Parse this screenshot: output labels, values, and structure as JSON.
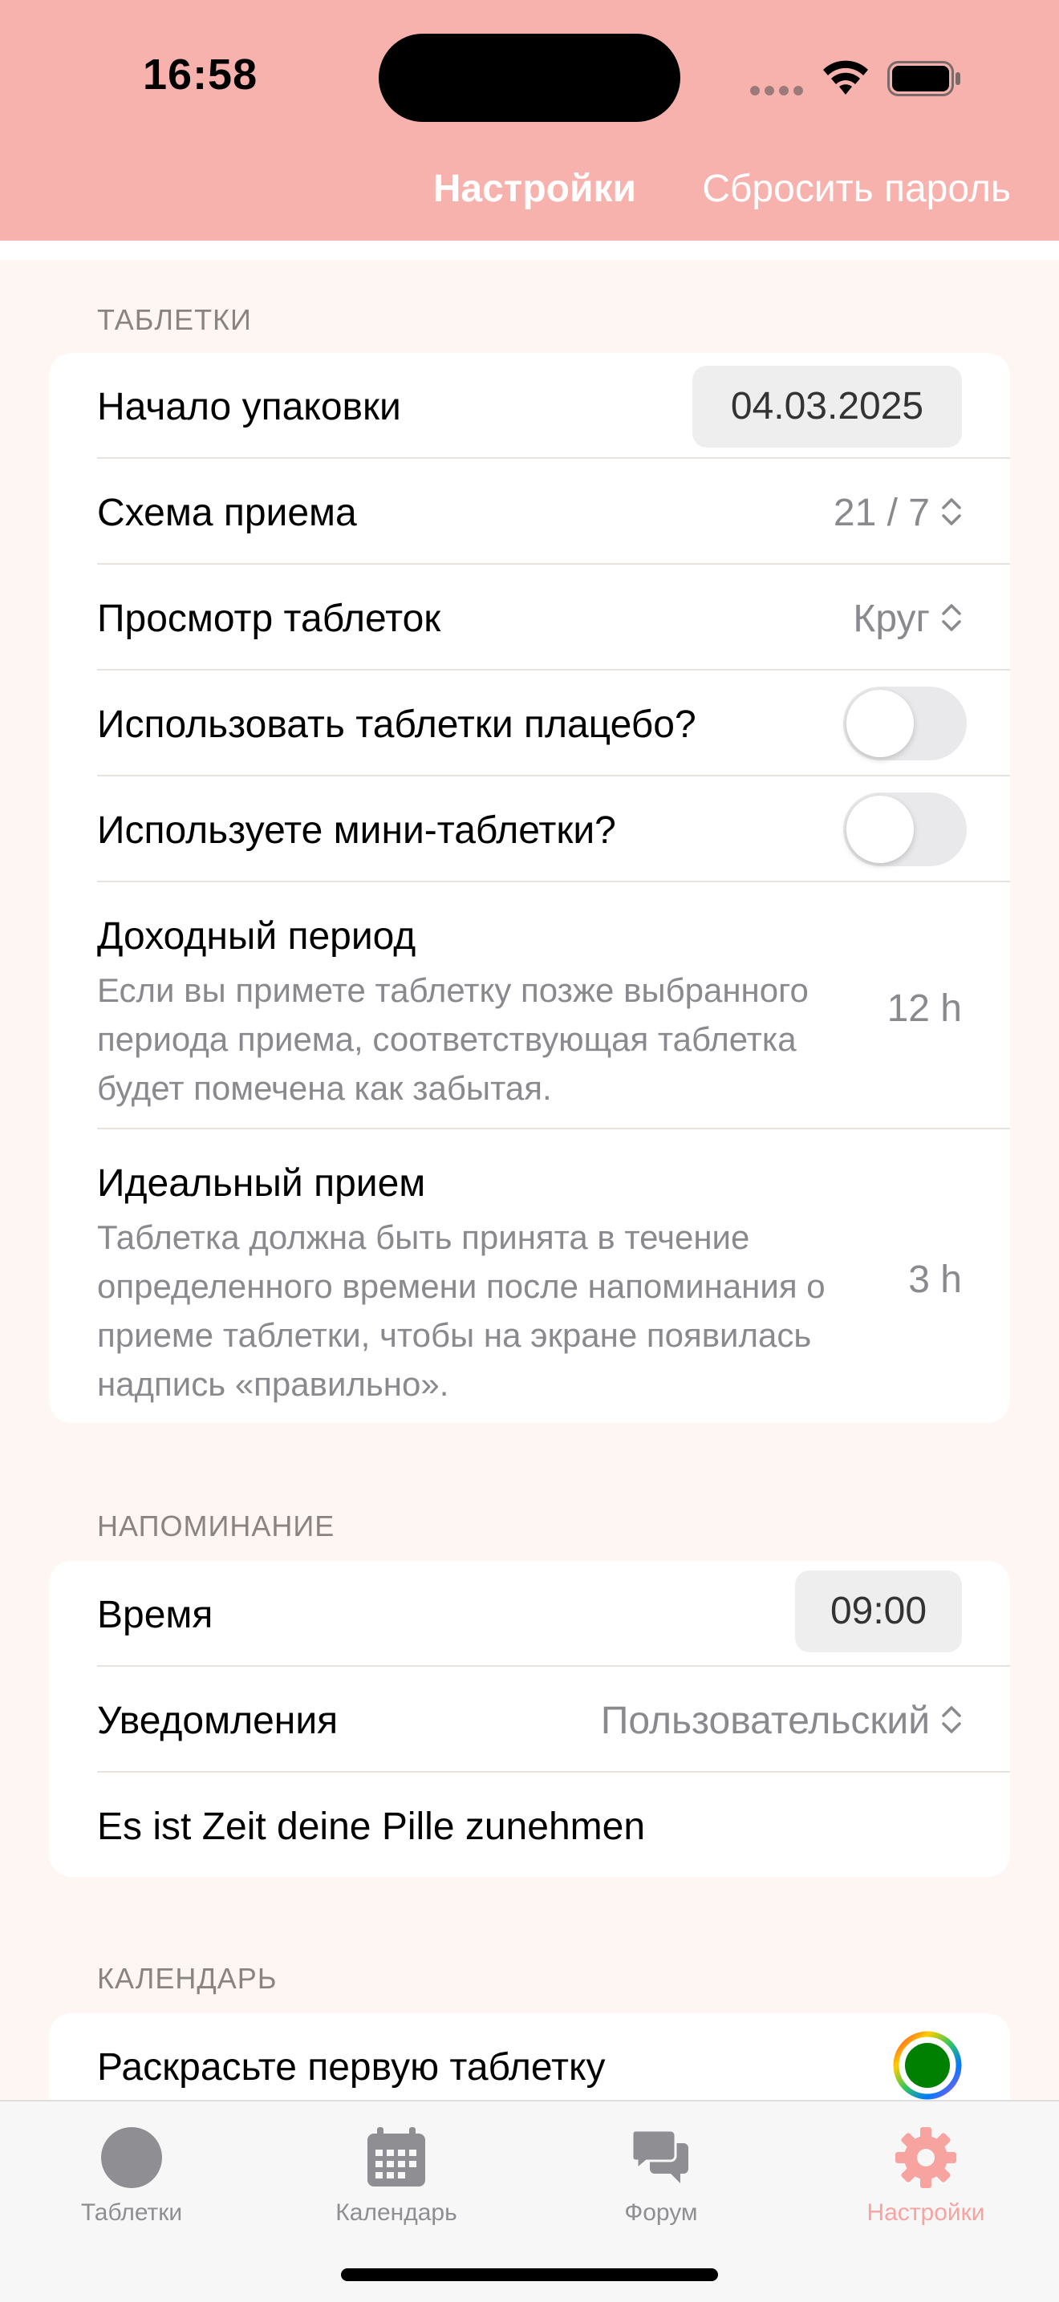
{
  "status_bar": {
    "time": "16:58"
  },
  "nav": {
    "title": "Настройки",
    "action": "Сбросить пароль"
  },
  "sections": {
    "pills": {
      "header": "ТАБЛЕТКИ",
      "pack_start": {
        "label": "Начало упаковки",
        "value": "04.03.2025"
      },
      "schedule": {
        "label": "Схема приема",
        "value": "21 / 7"
      },
      "view": {
        "label": "Просмотр таблеток",
        "value": "Круг"
      },
      "placebo": {
        "label": "Использовать таблетки плацебо?",
        "on": false
      },
      "mini": {
        "label": "Используете мини-таблетки?",
        "on": false
      },
      "window": {
        "label": "Доходный период",
        "description": "Если вы примете таблетку позже выбранного периода приема, соответствующая таблетка будет помечена как забытая.",
        "value": "12 h"
      },
      "ideal": {
        "label": "Идеальный прием",
        "description": "Таблетка должна быть принята в течение определенного времени после напоминания о приеме таблетки, чтобы на экране появилась надпись «правильно».",
        "value": "3 h"
      }
    },
    "reminder": {
      "header": "НАПОМИНАНИЕ",
      "time": {
        "label": "Время",
        "value": "09:00"
      },
      "notifications": {
        "label": "Уведомления",
        "value": "Пользовательский"
      },
      "message": {
        "label": "Es ist Zeit deine Pille zunehmen"
      }
    },
    "calendar": {
      "header": "КАЛЕНДАРЬ",
      "first_pill_color": {
        "label": "Раскрасьте первую таблетку",
        "color": "#008000"
      }
    }
  },
  "tabs": [
    {
      "label": "Таблетки",
      "icon": "pill-circle-icon",
      "active": false
    },
    {
      "label": "Календарь",
      "icon": "calendar-icon",
      "active": false
    },
    {
      "label": "Форум",
      "icon": "chat-bubbles-icon",
      "active": false
    },
    {
      "label": "Настройки",
      "icon": "gear-icon",
      "active": true
    }
  ],
  "colors": {
    "header_bg": "#f8b2ae",
    "accent": "#f7a3a0",
    "page_bg": "#fdf6f3",
    "secondary_text": "#8a8a8e"
  }
}
